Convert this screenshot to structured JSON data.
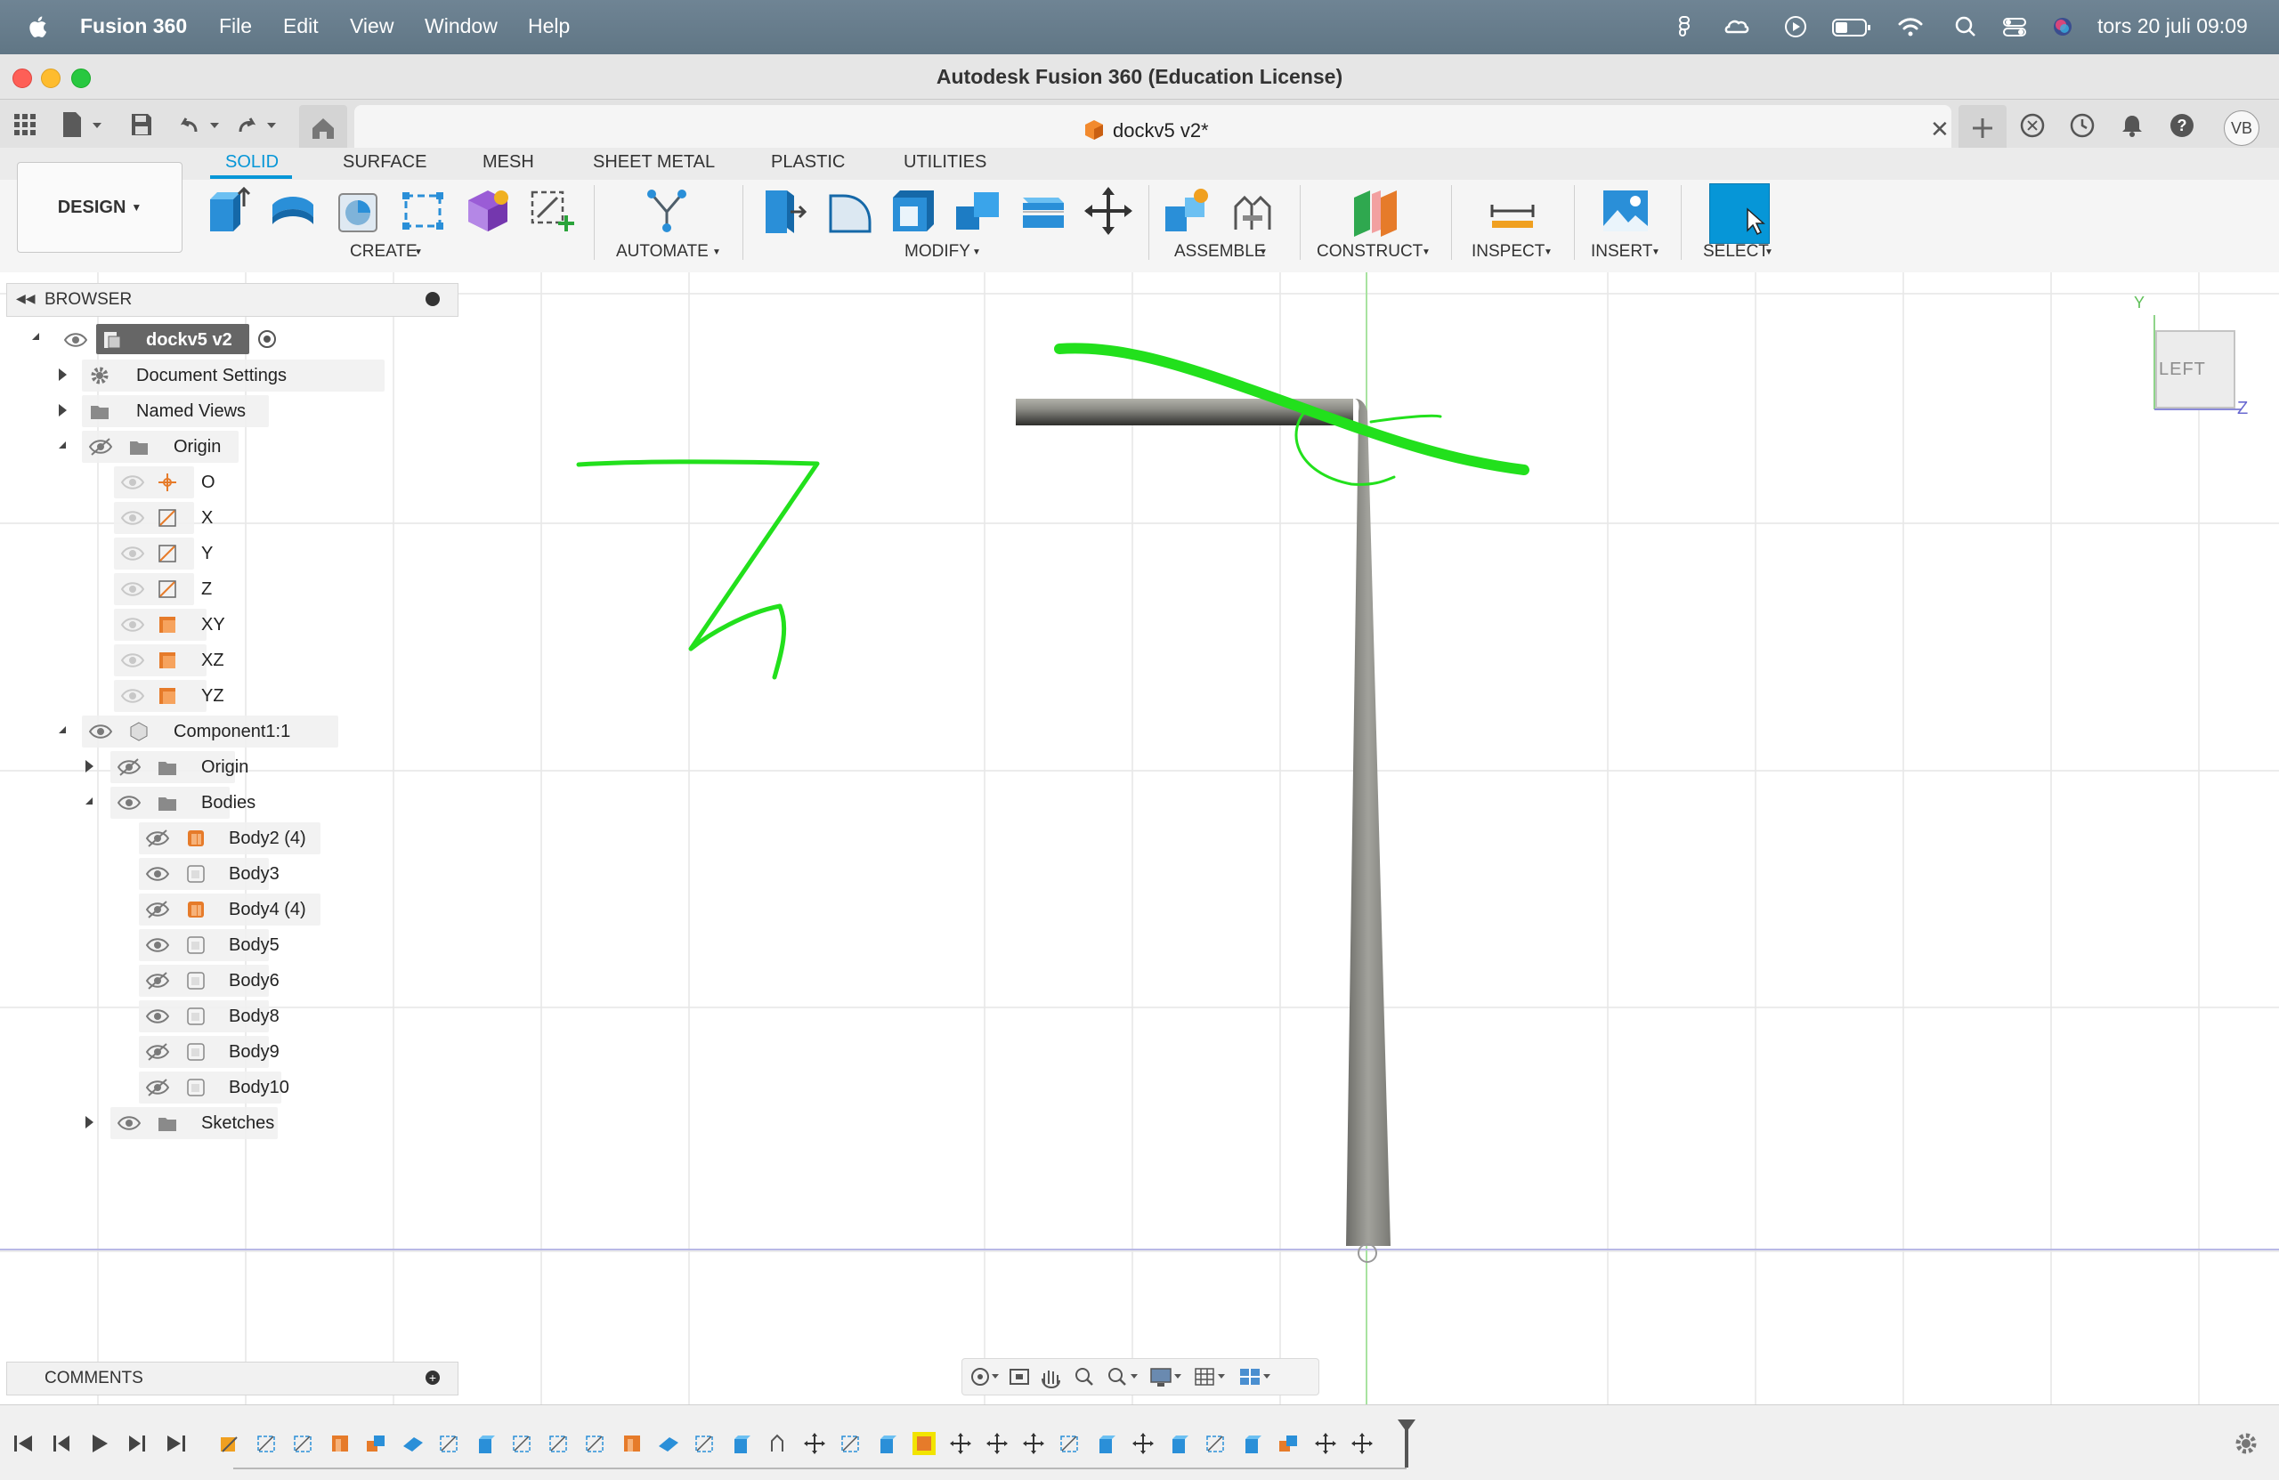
{
  "menubar": {
    "app_name": "Fusion 360",
    "items": [
      "File",
      "Edit",
      "View",
      "Window",
      "Help"
    ],
    "clock": "tors 20 juli 09:09"
  },
  "window": {
    "title": "Autodesk Fusion 360 (Education License)"
  },
  "tab": {
    "document_name": "dockv5 v2*",
    "user_initials": "VB"
  },
  "ribbon": {
    "workspace": "DESIGN",
    "tabs": [
      "SOLID",
      "SURFACE",
      "MESH",
      "SHEET METAL",
      "PLASTIC",
      "UTILITIES"
    ],
    "active_tab": "SOLID",
    "groups": [
      "CREATE",
      "AUTOMATE",
      "MODIFY",
      "ASSEMBLE",
      "CONSTRUCT",
      "INSPECT",
      "INSERT",
      "SELECT"
    ]
  },
  "browser": {
    "title": "BROWSER",
    "root": "dockv5 v2",
    "rows": [
      {
        "label": "Document Settings"
      },
      {
        "label": "Named Views"
      },
      {
        "label": "Origin"
      },
      {
        "label": "O"
      },
      {
        "label": "X"
      },
      {
        "label": "Y"
      },
      {
        "label": "Z"
      },
      {
        "label": "XY"
      },
      {
        "label": "XZ"
      },
      {
        "label": "YZ"
      },
      {
        "label": "Component1:1"
      },
      {
        "label": "Origin"
      },
      {
        "label": "Bodies"
      },
      {
        "label": "Body2 (4)"
      },
      {
        "label": "Body3"
      },
      {
        "label": "Body4 (4)"
      },
      {
        "label": "Body5"
      },
      {
        "label": "Body6"
      },
      {
        "label": "Body8"
      },
      {
        "label": "Body9"
      },
      {
        "label": "Body10"
      },
      {
        "label": "Sketches"
      }
    ]
  },
  "comments": {
    "title": "COMMENTS"
  },
  "viewcube": {
    "face": "LEFT",
    "axis_y": "Y",
    "axis_z": "Z"
  },
  "colors": {
    "accent": "#0696d7",
    "annotation_green": "#22e01c",
    "body_gray": "#8f8f89"
  },
  "icons": {
    "menubar_right": [
      "figma-icon",
      "creative-cloud-icon",
      "play-icon",
      "battery-icon",
      "wifi-icon",
      "spotlight-icon",
      "control-center-icon",
      "siri-icon"
    ],
    "tabbar_right": [
      "new-tab-icon",
      "extensions-icon",
      "job-status-icon",
      "notifications-icon",
      "help-icon"
    ]
  }
}
